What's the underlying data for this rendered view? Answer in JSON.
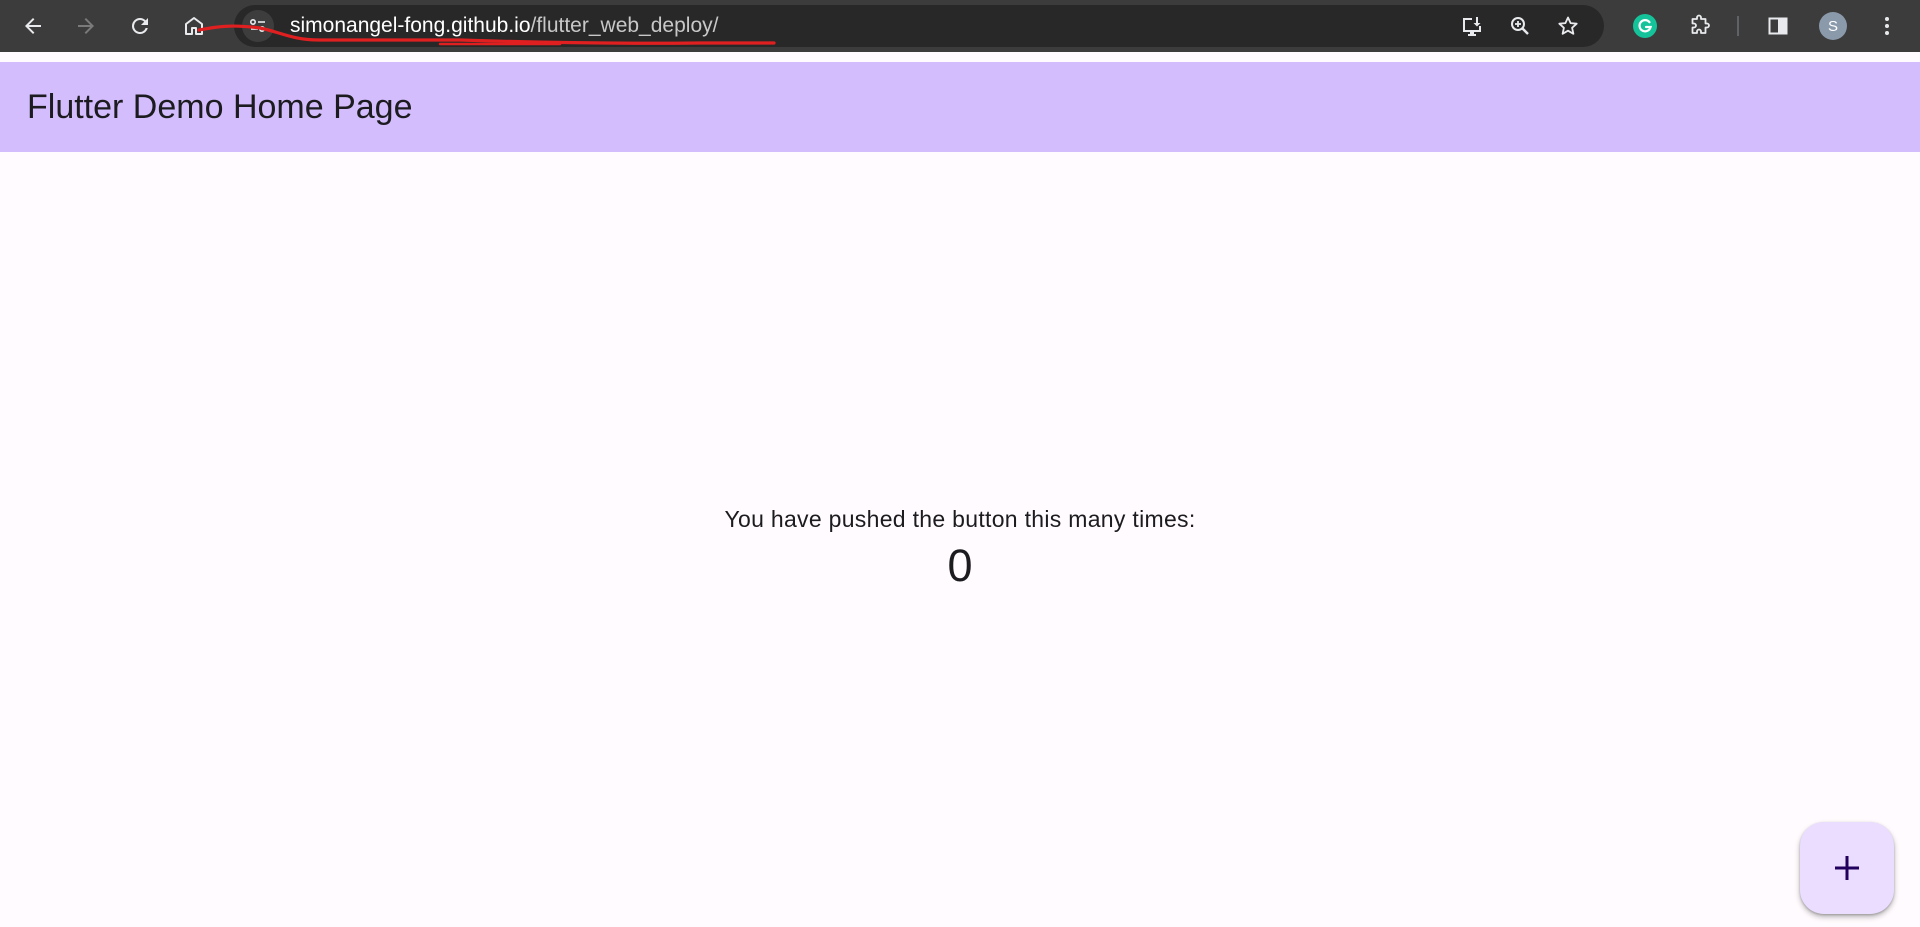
{
  "browser": {
    "url_host": "simonangel-fong.github.io",
    "url_path": "/flutter_web_deploy/",
    "profile_initial": "S",
    "icons": [
      "back-icon",
      "forward-icon",
      "reload-icon",
      "home-icon",
      "site-info-icon",
      "install-app-icon",
      "zoom-icon",
      "bookmark-star-icon",
      "grammarly-icon",
      "extensions-icon",
      "side-panel-icon",
      "menu-dots-icon"
    ]
  },
  "app": {
    "title": "Flutter Demo Home Page",
    "message": "You have pushed the button this many times:",
    "counter": "0",
    "fab_icon": "add-icon"
  },
  "colors": {
    "appbar": "#d4bdfd",
    "background": "#fffbfe",
    "fab": "#eaddff",
    "annotation": "#e02020"
  }
}
